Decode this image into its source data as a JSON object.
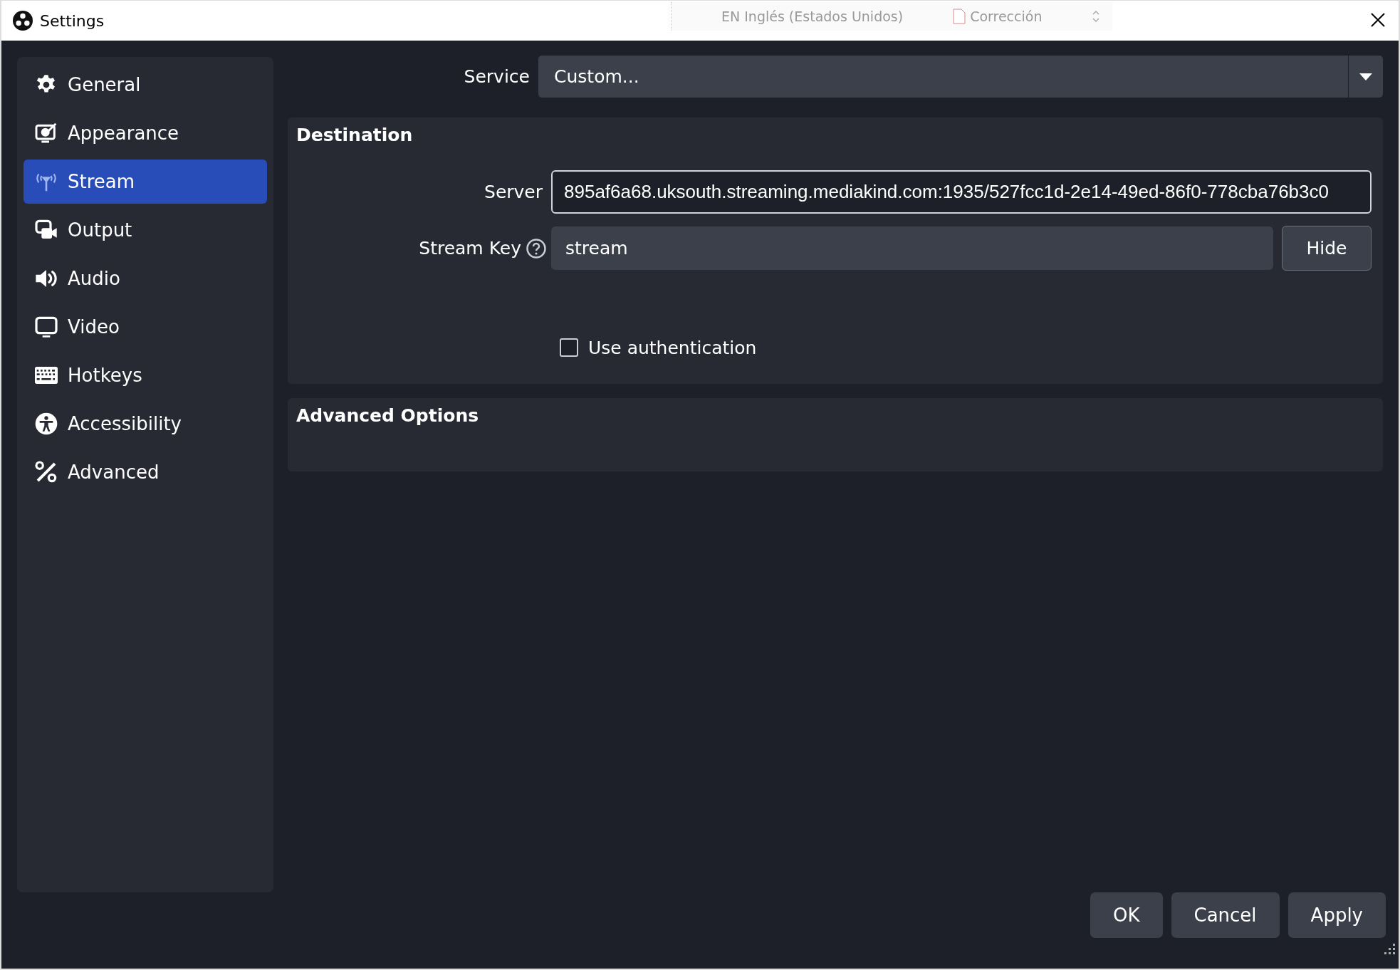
{
  "window": {
    "title": "Settings"
  },
  "language_bar": {
    "language": "EN Inglés (Estados Unidos)",
    "tool": "Corrección"
  },
  "sidebar": {
    "items": [
      {
        "label": "General",
        "selected": false
      },
      {
        "label": "Appearance",
        "selected": false
      },
      {
        "label": "Stream",
        "selected": true
      },
      {
        "label": "Output",
        "selected": false
      },
      {
        "label": "Audio",
        "selected": false
      },
      {
        "label": "Video",
        "selected": false
      },
      {
        "label": "Hotkeys",
        "selected": false
      },
      {
        "label": "Accessibility",
        "selected": false
      },
      {
        "label": "Advanced",
        "selected": false
      }
    ]
  },
  "service": {
    "label": "Service",
    "value": "Custom..."
  },
  "destination": {
    "title": "Destination",
    "server_label": "Server",
    "server_value": "895af6a68.uksouth.streaming.mediakind.com:1935/527fcc1d-2e14-49ed-86f0-778cba76b3c0",
    "stream_key_label": "Stream Key",
    "stream_key_value": "stream",
    "hide_button": "Hide",
    "use_authentication": {
      "label": "Use authentication",
      "checked": false
    }
  },
  "advanced_options": {
    "title": "Advanced Options"
  },
  "buttons": [
    "OK",
    "Cancel",
    "Apply"
  ]
}
